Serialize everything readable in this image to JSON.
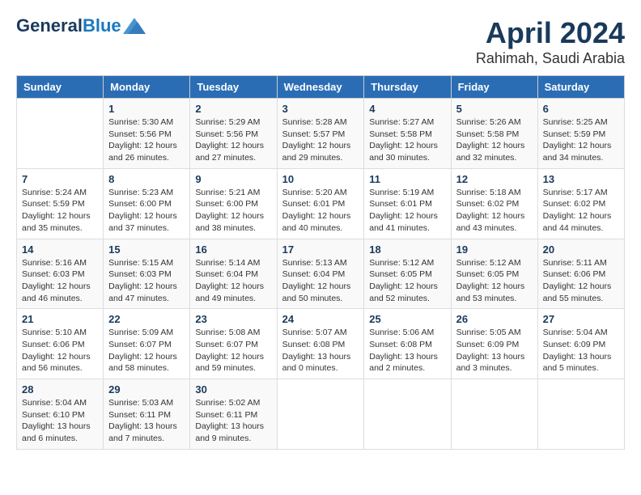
{
  "logo": {
    "line1": "General",
    "line2": "Blue"
  },
  "title": "April 2024",
  "location": "Rahimah, Saudi Arabia",
  "weekdays": [
    "Sunday",
    "Monday",
    "Tuesday",
    "Wednesday",
    "Thursday",
    "Friday",
    "Saturday"
  ],
  "weeks": [
    [
      {
        "num": "",
        "info": ""
      },
      {
        "num": "1",
        "info": "Sunrise: 5:30 AM\nSunset: 5:56 PM\nDaylight: 12 hours\nand 26 minutes."
      },
      {
        "num": "2",
        "info": "Sunrise: 5:29 AM\nSunset: 5:56 PM\nDaylight: 12 hours\nand 27 minutes."
      },
      {
        "num": "3",
        "info": "Sunrise: 5:28 AM\nSunset: 5:57 PM\nDaylight: 12 hours\nand 29 minutes."
      },
      {
        "num": "4",
        "info": "Sunrise: 5:27 AM\nSunset: 5:58 PM\nDaylight: 12 hours\nand 30 minutes."
      },
      {
        "num": "5",
        "info": "Sunrise: 5:26 AM\nSunset: 5:58 PM\nDaylight: 12 hours\nand 32 minutes."
      },
      {
        "num": "6",
        "info": "Sunrise: 5:25 AM\nSunset: 5:59 PM\nDaylight: 12 hours\nand 34 minutes."
      }
    ],
    [
      {
        "num": "7",
        "info": "Sunrise: 5:24 AM\nSunset: 5:59 PM\nDaylight: 12 hours\nand 35 minutes."
      },
      {
        "num": "8",
        "info": "Sunrise: 5:23 AM\nSunset: 6:00 PM\nDaylight: 12 hours\nand 37 minutes."
      },
      {
        "num": "9",
        "info": "Sunrise: 5:21 AM\nSunset: 6:00 PM\nDaylight: 12 hours\nand 38 minutes."
      },
      {
        "num": "10",
        "info": "Sunrise: 5:20 AM\nSunset: 6:01 PM\nDaylight: 12 hours\nand 40 minutes."
      },
      {
        "num": "11",
        "info": "Sunrise: 5:19 AM\nSunset: 6:01 PM\nDaylight: 12 hours\nand 41 minutes."
      },
      {
        "num": "12",
        "info": "Sunrise: 5:18 AM\nSunset: 6:02 PM\nDaylight: 12 hours\nand 43 minutes."
      },
      {
        "num": "13",
        "info": "Sunrise: 5:17 AM\nSunset: 6:02 PM\nDaylight: 12 hours\nand 44 minutes."
      }
    ],
    [
      {
        "num": "14",
        "info": "Sunrise: 5:16 AM\nSunset: 6:03 PM\nDaylight: 12 hours\nand 46 minutes."
      },
      {
        "num": "15",
        "info": "Sunrise: 5:15 AM\nSunset: 6:03 PM\nDaylight: 12 hours\nand 47 minutes."
      },
      {
        "num": "16",
        "info": "Sunrise: 5:14 AM\nSunset: 6:04 PM\nDaylight: 12 hours\nand 49 minutes."
      },
      {
        "num": "17",
        "info": "Sunrise: 5:13 AM\nSunset: 6:04 PM\nDaylight: 12 hours\nand 50 minutes."
      },
      {
        "num": "18",
        "info": "Sunrise: 5:12 AM\nSunset: 6:05 PM\nDaylight: 12 hours\nand 52 minutes."
      },
      {
        "num": "19",
        "info": "Sunrise: 5:12 AM\nSunset: 6:05 PM\nDaylight: 12 hours\nand 53 minutes."
      },
      {
        "num": "20",
        "info": "Sunrise: 5:11 AM\nSunset: 6:06 PM\nDaylight: 12 hours\nand 55 minutes."
      }
    ],
    [
      {
        "num": "21",
        "info": "Sunrise: 5:10 AM\nSunset: 6:06 PM\nDaylight: 12 hours\nand 56 minutes."
      },
      {
        "num": "22",
        "info": "Sunrise: 5:09 AM\nSunset: 6:07 PM\nDaylight: 12 hours\nand 58 minutes."
      },
      {
        "num": "23",
        "info": "Sunrise: 5:08 AM\nSunset: 6:07 PM\nDaylight: 12 hours\nand 59 minutes."
      },
      {
        "num": "24",
        "info": "Sunrise: 5:07 AM\nSunset: 6:08 PM\nDaylight: 13 hours\nand 0 minutes."
      },
      {
        "num": "25",
        "info": "Sunrise: 5:06 AM\nSunset: 6:08 PM\nDaylight: 13 hours\nand 2 minutes."
      },
      {
        "num": "26",
        "info": "Sunrise: 5:05 AM\nSunset: 6:09 PM\nDaylight: 13 hours\nand 3 minutes."
      },
      {
        "num": "27",
        "info": "Sunrise: 5:04 AM\nSunset: 6:09 PM\nDaylight: 13 hours\nand 5 minutes."
      }
    ],
    [
      {
        "num": "28",
        "info": "Sunrise: 5:04 AM\nSunset: 6:10 PM\nDaylight: 13 hours\nand 6 minutes."
      },
      {
        "num": "29",
        "info": "Sunrise: 5:03 AM\nSunset: 6:11 PM\nDaylight: 13 hours\nand 7 minutes."
      },
      {
        "num": "30",
        "info": "Sunrise: 5:02 AM\nSunset: 6:11 PM\nDaylight: 13 hours\nand 9 minutes."
      },
      {
        "num": "",
        "info": ""
      },
      {
        "num": "",
        "info": ""
      },
      {
        "num": "",
        "info": ""
      },
      {
        "num": "",
        "info": ""
      }
    ]
  ]
}
